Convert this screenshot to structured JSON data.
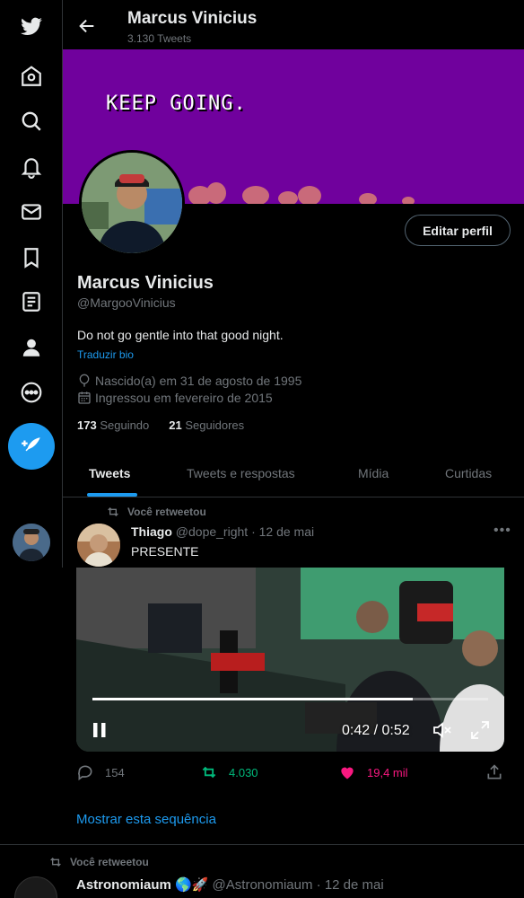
{
  "profile": {
    "name": "Marcus Vinicius",
    "tweet_count": "3.130 Tweets",
    "banner_text": "KEEP GOING.",
    "handle": "@MargooVinicius",
    "bio": "Do not go gentle into that good night.",
    "translate_bio": "Traduzir bio",
    "born": "Nascido(a) em 31 de agosto de 1995",
    "joined": "Ingressou em fevereiro de 2015",
    "following_count": "173",
    "following_label": "Seguindo",
    "followers_count": "21",
    "followers_label": "Seguidores",
    "edit_label": "Editar perfil"
  },
  "tabs": [
    {
      "label": "Tweets",
      "active": true
    },
    {
      "label": "Tweets e respostas",
      "active": false
    },
    {
      "label": "Mídia",
      "active": false
    },
    {
      "label": "Curtidas",
      "active": false
    }
  ],
  "tweet1": {
    "retweet_label": "Você retweetou",
    "author": "Thiago",
    "handle": "@dope_right",
    "date": "· 12 de mai",
    "text": "PRESENTE",
    "video_time": "0:42 / 0:52",
    "video_progress": 0.81,
    "replies": "154",
    "retweets": "4.030",
    "likes": "19,4 mil",
    "show_thread": "Mostrar esta sequência"
  },
  "tweet2": {
    "retweet_label": "Você retweetou",
    "author": "Astronomiaum 🌎🚀",
    "handle": "@Astronomiaum",
    "date": "· 12 de mai"
  },
  "icons": {
    "nav": [
      "twitter-bird-icon",
      "home-icon",
      "explore-icon",
      "notifications-icon",
      "messages-icon",
      "bookmarks-icon",
      "lists-icon",
      "profile-icon",
      "more-icon"
    ],
    "compose": "compose-tweet-icon"
  },
  "colors": {
    "accent": "#1d9bf0",
    "banner": "#70019d",
    "retweet": "#00ba7c",
    "like": "#f91880"
  }
}
